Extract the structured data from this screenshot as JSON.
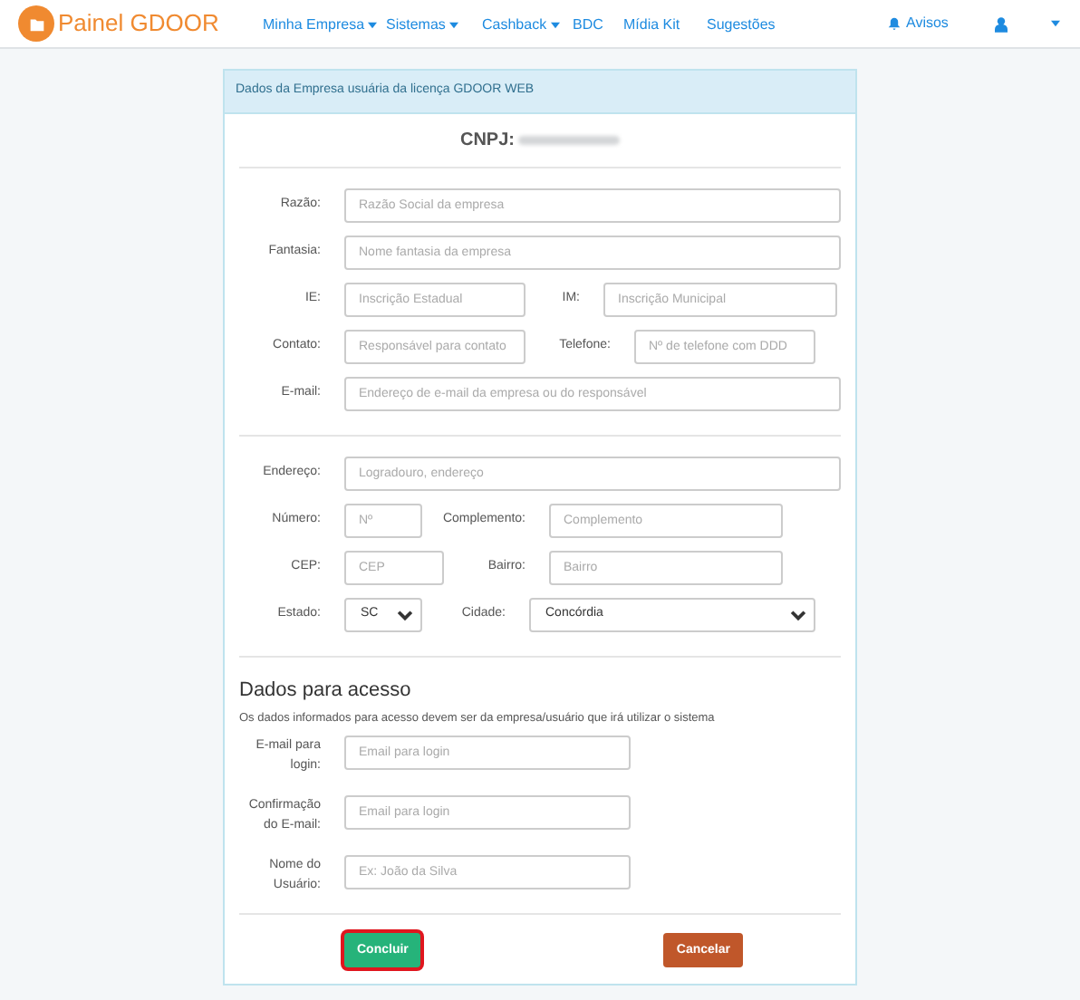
{
  "navbar": {
    "brand": "Painel GDOOR",
    "items": [
      {
        "label": "Minha Empresa",
        "dropdown": true
      },
      {
        "label": "Sistemas",
        "dropdown": true
      },
      {
        "label": "Cashback",
        "dropdown": true
      },
      {
        "label": "BDC",
        "dropdown": false
      },
      {
        "label": "Mídia Kit",
        "dropdown": false
      },
      {
        "label": "Sugestões",
        "dropdown": false
      }
    ],
    "alerts": "Avisos"
  },
  "panel": {
    "header": "Dados da Empresa usuária da licença GDOOR WEB",
    "cnpj_label": "CNPJ:",
    "company_rows": [
      [
        {
          "kind": "input",
          "label": "Razão:",
          "placeholder": "Razão Social da empresa"
        }
      ],
      [
        {
          "kind": "input",
          "label": "Fantasia:",
          "placeholder": "Nome fantasia da empresa"
        }
      ],
      [
        {
          "kind": "input",
          "label": "IE:",
          "placeholder": "Inscrição Estadual"
        },
        {
          "kind": "input",
          "label": "IM:",
          "placeholder": "Inscrição Municipal"
        }
      ],
      [
        {
          "kind": "input",
          "label": "Contato:",
          "placeholder": "Responsável para contato"
        },
        {
          "kind": "input",
          "label": "Telefone:",
          "placeholder": "Nº de telefone com DDD"
        }
      ],
      [
        {
          "kind": "input",
          "label": "E-mail:",
          "placeholder": "Endereço de e-mail da empresa ou do responsável"
        }
      ]
    ],
    "address_rows": [
      [
        {
          "kind": "input",
          "label": "Endereço:",
          "placeholder": "Logradouro, endereço"
        }
      ],
      [
        {
          "kind": "input",
          "label": "Número:",
          "placeholder": "Nº"
        },
        {
          "kind": "input",
          "label": "Complemento:",
          "placeholder": "Complemento"
        }
      ],
      [
        {
          "kind": "input",
          "label": "CEP:",
          "placeholder": "CEP"
        },
        {
          "kind": "input",
          "label": "Bairro:",
          "placeholder": "Bairro"
        }
      ],
      [
        {
          "kind": "select",
          "label": "Estado:",
          "value": "SC"
        },
        {
          "kind": "select",
          "label": "Cidade:",
          "value": "Concórdia"
        }
      ]
    ],
    "access": {
      "title": "Dados para acesso",
      "note": "Os dados informados para acesso devem ser da empresa/usuário que irá utilizar o sistema",
      "fields": [
        {
          "label": "E-mail para login:",
          "placeholder": "Email para login"
        },
        {
          "label": "Confirmação do E-mail:",
          "placeholder": "Email para login"
        },
        {
          "label": "Nome do Usuário:",
          "placeholder": "Ex: João da Silva"
        }
      ]
    },
    "buttons": [
      {
        "label": "Concluir",
        "kind": "primary",
        "highlighted": true
      },
      {
        "label": "Cancelar",
        "kind": "cancel",
        "highlighted": false
      }
    ]
  }
}
